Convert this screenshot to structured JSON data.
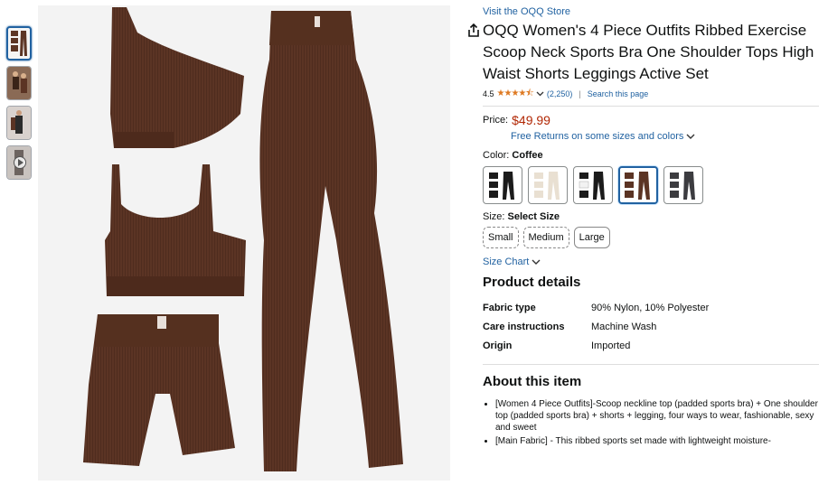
{
  "thumbnails": [
    {
      "name": "thumb-1",
      "selected": true,
      "type": "image"
    },
    {
      "name": "thumb-2",
      "selected": false,
      "type": "image"
    },
    {
      "name": "thumb-3",
      "selected": false,
      "type": "image"
    },
    {
      "name": "thumb-4",
      "selected": false,
      "type": "video"
    }
  ],
  "main_image": {
    "icon": "share-icon"
  },
  "product": {
    "store_link": "Visit the OQQ Store",
    "title": "OQQ Women's 4 Piece Outfits Ribbed Exercise Scoop Neck Sports Bra One Shoulder Tops High Waist Shorts Leggings Active Set",
    "rating": "4.5",
    "rating_count": "(2,250)",
    "search_link": "Search this page",
    "price_label": "Price:",
    "price": "$49.99",
    "returns": "Free Returns on some sizes and colors",
    "color_label": "Color: ",
    "color_value": "Coffee",
    "size_label": "Size: ",
    "size_value": "Select Size",
    "sizes": [
      "Small",
      "Medium",
      "Large"
    ],
    "size_chart": "Size Chart"
  },
  "colors": {
    "brand_link": "#2162a1",
    "price": "#b12704",
    "stars": "#de7921",
    "garment": "#5b3424"
  },
  "details": {
    "heading": "Product details",
    "rows": [
      {
        "key": "Fabric type",
        "value": "90% Nylon, 10% Polyester"
      },
      {
        "key": "Care instructions",
        "value": "Machine Wash"
      },
      {
        "key": "Origin",
        "value": "Imported"
      }
    ]
  },
  "about": {
    "heading": "About this item",
    "bullets": [
      "[Women 4 Piece Outfits]-Scoop neckline top (padded sports bra) + One shoulder top (padded sports bra) + shorts + legging, four ways to wear, fashionable, sexy and sweet",
      "[Main Fabric] - This ribbed sports set made with lightweight moisture-"
    ]
  }
}
